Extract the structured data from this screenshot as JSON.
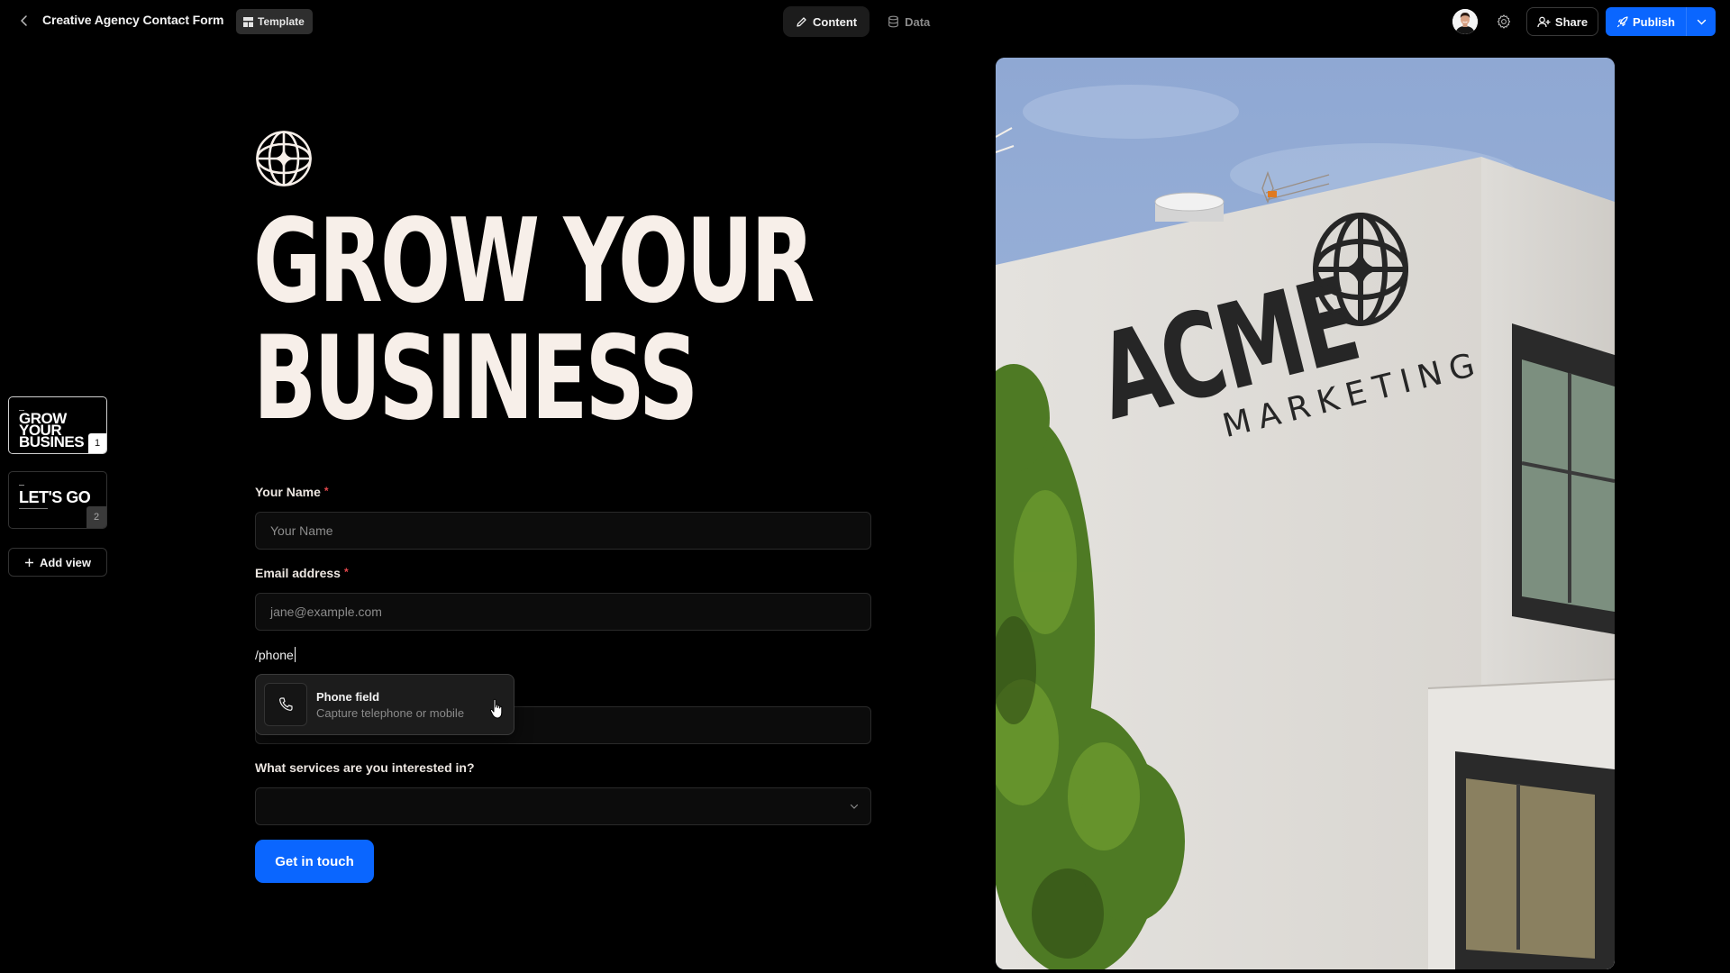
{
  "topbar": {
    "back_icon": "chevron-left-icon",
    "title": "Creative Agency Contact Form",
    "template_label": "Template",
    "template_icon": "layout-icon",
    "tabs": [
      {
        "label": "Content",
        "icon": "pencil-icon",
        "active": true
      },
      {
        "label": "Data",
        "icon": "database-icon",
        "active": false
      }
    ],
    "settings_icon": "gear-icon",
    "share_label": "Share",
    "share_icon": "user-plus-icon",
    "publish_label": "Publish",
    "publish_icon": "rocket-icon",
    "publish_menu_icon": "chevron-down-icon"
  },
  "sidebar": {
    "views": [
      {
        "thumb_text": "GROW YOUR BUSINES",
        "number": "1",
        "selected": true
      },
      {
        "thumb_text": "LET'S GO",
        "number": "2",
        "selected": false
      }
    ],
    "add_view_label": "Add view"
  },
  "form": {
    "logo_icon": "globe-star-icon",
    "headline_line1": "GROW YOUR",
    "headline_line2": "BUSINESS",
    "fields": [
      {
        "label": "Your Name",
        "required": "*",
        "placeholder": "Your Name",
        "value": ""
      },
      {
        "label": "Email address",
        "required": "*",
        "placeholder": "jane@example.com",
        "value": ""
      }
    ],
    "slash_command_text": "/phone",
    "command_menu": {
      "items": [
        {
          "title": "Phone field",
          "description": "Capture telephone or mobile",
          "icon": "phone-icon"
        }
      ]
    },
    "services_label": "What services are you interested in?",
    "services_value": "",
    "submit_label": "Get in touch"
  },
  "colors": {
    "accent": "#0a66ff",
    "headline": "#f7efe9",
    "background": "#000000",
    "required": "#e5484d"
  },
  "hero_image": {
    "sign_text_primary": "ACME",
    "sign_text_secondary": "MARKETING"
  }
}
